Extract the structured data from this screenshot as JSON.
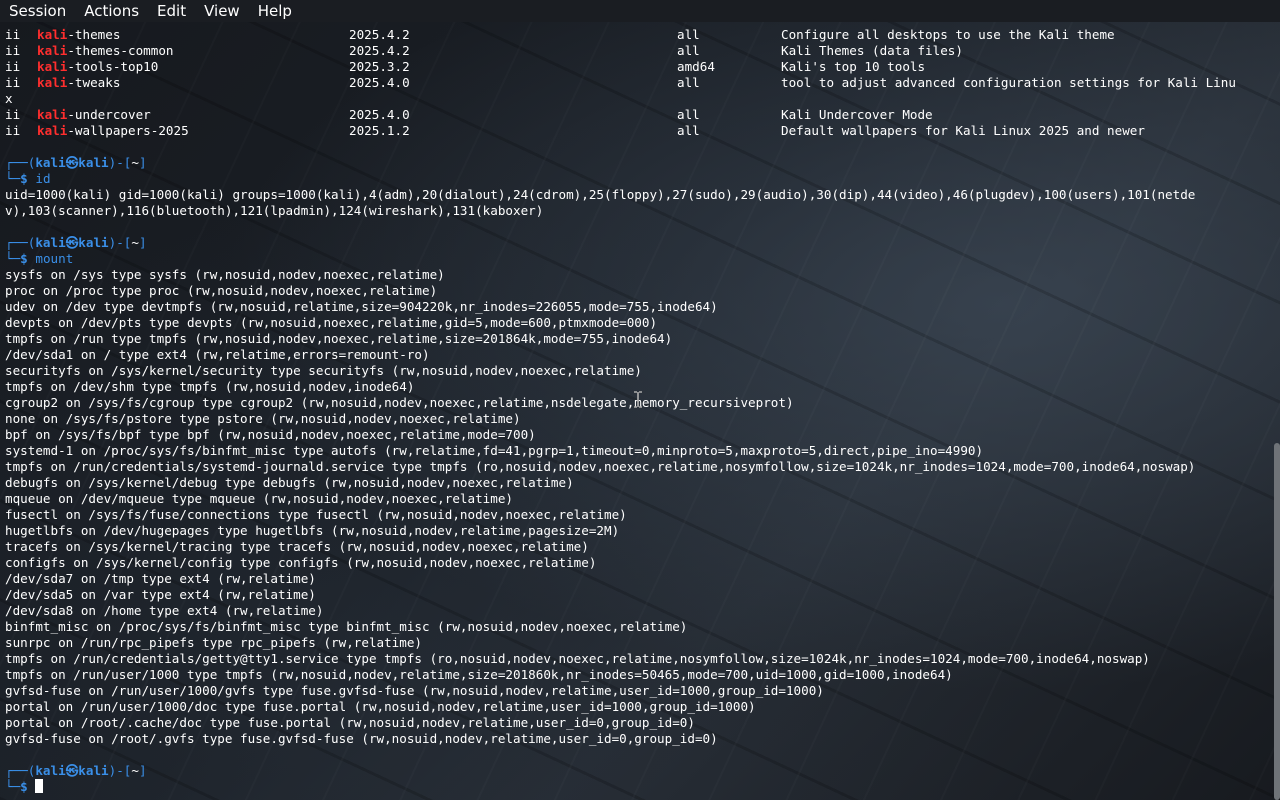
{
  "menu": [
    "Session",
    "Actions",
    "Edit",
    "View",
    "Help"
  ],
  "packages": [
    {
      "status": "ii",
      "prefix": "kali",
      "rest": "-themes",
      "version": "2025.4.2",
      "arch": "all",
      "desc": "Configure all desktops to use the Kali theme"
    },
    {
      "status": "ii",
      "prefix": "kali",
      "rest": "-themes-common",
      "version": "2025.4.2",
      "arch": "all",
      "desc": "Kali Themes (data files)"
    },
    {
      "status": "ii",
      "prefix": "kali",
      "rest": "-tools-top10",
      "version": "2025.3.2",
      "arch": "amd64",
      "desc": "Kali's top 10 tools"
    },
    {
      "status": "ii",
      "prefix": "kali",
      "rest": "-tweaks",
      "version": "2025.4.0",
      "arch": "all",
      "desc": "tool to adjust advanced configuration settings for Kali Linu"
    },
    {
      "status": "ii",
      "prefix": "kali",
      "rest": "-undercover",
      "version": "2025.4.0",
      "arch": "all",
      "desc": "Kali Undercover Mode"
    },
    {
      "status": "ii",
      "prefix": "kali",
      "rest": "-wallpapers-2025",
      "version": "2025.1.2",
      "arch": "all",
      "desc": "Default wallpapers for Kali Linux 2025 and newer"
    }
  ],
  "wrap_char": "x",
  "prompt": {
    "open": "┌──(",
    "user": "kali",
    "at": "㉿",
    "host": "kali",
    "mid": ")-[",
    "dir": "~",
    "close": "]",
    "tail": "└─",
    "sign": "$"
  },
  "cmd_id": "id",
  "id_output": [
    "uid=1000(kali) gid=1000(kali) groups=1000(kali),4(adm),20(dialout),24(cdrom),25(floppy),27(sudo),29(audio),30(dip),44(video),46(plugdev),100(users),101(netde",
    "v),103(scanner),116(bluetooth),121(lpadmin),124(wireshark),131(kaboxer)"
  ],
  "cmd_mount": "mount",
  "mount_output": [
    "sysfs on /sys type sysfs (rw,nosuid,nodev,noexec,relatime)",
    "proc on /proc type proc (rw,nosuid,nodev,noexec,relatime)",
    "udev on /dev type devtmpfs (rw,nosuid,relatime,size=904220k,nr_inodes=226055,mode=755,inode64)",
    "devpts on /dev/pts type devpts (rw,nosuid,noexec,relatime,gid=5,mode=600,ptmxmode=000)",
    "tmpfs on /run type tmpfs (rw,nosuid,nodev,noexec,relatime,size=201864k,mode=755,inode64)",
    "/dev/sda1 on / type ext4 (rw,relatime,errors=remount-ro)",
    "securityfs on /sys/kernel/security type securityfs (rw,nosuid,nodev,noexec,relatime)",
    "tmpfs on /dev/shm type tmpfs (rw,nosuid,nodev,inode64)",
    "cgroup2 on /sys/fs/cgroup type cgroup2 (rw,nosuid,nodev,noexec,relatime,nsdelegate,memory_recursiveprot)",
    "none on /sys/fs/pstore type pstore (rw,nosuid,nodev,noexec,relatime)",
    "bpf on /sys/fs/bpf type bpf (rw,nosuid,nodev,noexec,relatime,mode=700)",
    "systemd-1 on /proc/sys/fs/binfmt_misc type autofs (rw,relatime,fd=41,pgrp=1,timeout=0,minproto=5,maxproto=5,direct,pipe_ino=4990)",
    "tmpfs on /run/credentials/systemd-journald.service type tmpfs (ro,nosuid,nodev,noexec,relatime,nosymfollow,size=1024k,nr_inodes=1024,mode=700,inode64,noswap)",
    "debugfs on /sys/kernel/debug type debugfs (rw,nosuid,nodev,noexec,relatime)",
    "mqueue on /dev/mqueue type mqueue (rw,nosuid,nodev,noexec,relatime)",
    "fusectl on /sys/fs/fuse/connections type fusectl (rw,nosuid,nodev,noexec,relatime)",
    "hugetlbfs on /dev/hugepages type hugetlbfs (rw,nosuid,nodev,relatime,pagesize=2M)",
    "tracefs on /sys/kernel/tracing type tracefs (rw,nosuid,nodev,noexec,relatime)",
    "configfs on /sys/kernel/config type configfs (rw,nosuid,nodev,noexec,relatime)",
    "/dev/sda7 on /tmp type ext4 (rw,relatime)",
    "/dev/sda5 on /var type ext4 (rw,relatime)",
    "/dev/sda8 on /home type ext4 (rw,relatime)",
    "binfmt_misc on /proc/sys/fs/binfmt_misc type binfmt_misc (rw,nosuid,nodev,noexec,relatime)",
    "sunrpc on /run/rpc_pipefs type rpc_pipefs (rw,relatime)",
    "tmpfs on /run/credentials/getty@tty1.service type tmpfs (ro,nosuid,nodev,noexec,relatime,nosymfollow,size=1024k,nr_inodes=1024,mode=700,inode64,noswap)",
    "tmpfs on /run/user/1000 type tmpfs (rw,nosuid,nodev,relatime,size=201860k,nr_inodes=50465,mode=700,uid=1000,gid=1000,inode64)",
    "gvfsd-fuse on /run/user/1000/gvfs type fuse.gvfsd-fuse (rw,nosuid,nodev,relatime,user_id=1000,group_id=1000)",
    "portal on /run/user/1000/doc type fuse.portal (rw,nosuid,nodev,relatime,user_id=1000,group_id=1000)",
    "portal on /root/.cache/doc type fuse.portal (rw,nosuid,nodev,relatime,user_id=0,group_id=0)",
    "gvfsd-fuse on /root/.gvfs type fuse.gvfsd-fuse (rw,nosuid,nodev,relatime,user_id=0,group_id=0)"
  ],
  "colors": {
    "prompt": "#3a8fe8",
    "highlight": "#ff2e2e",
    "text": "#ffffff",
    "menubar": "#1a1d22"
  }
}
